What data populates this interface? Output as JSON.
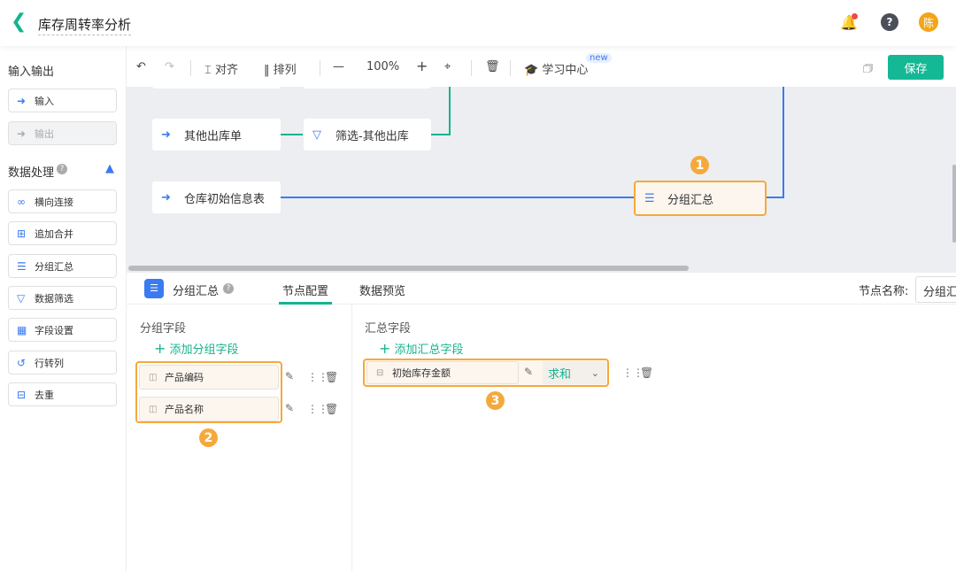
{
  "header": {
    "title": "库存周转率分析",
    "avatar": "陈",
    "help": "?"
  },
  "sidebar": {
    "io_title": "输入输出",
    "io_items": [
      {
        "label": "输入",
        "disabled": false
      },
      {
        "label": "输出",
        "disabled": true
      }
    ],
    "proc_title": "数据处理",
    "proc_items": [
      {
        "label": "横向连接"
      },
      {
        "label": "追加合并"
      },
      {
        "label": "分组汇总"
      },
      {
        "label": "数据筛选"
      },
      {
        "label": "字段设置"
      },
      {
        "label": "行转列"
      },
      {
        "label": "去重"
      }
    ]
  },
  "toolbar": {
    "align": "对齐",
    "arrange": "排列",
    "zoom": "100%",
    "learn": "学习中心",
    "new_badge": "new",
    "save": "保存"
  },
  "canvas": {
    "nodes": [
      {
        "label": "其他出库单"
      },
      {
        "label": "筛选-其他出库"
      },
      {
        "label": "仓库初始信息表"
      },
      {
        "label": "分组汇总"
      }
    ],
    "badge1": "1"
  },
  "panel": {
    "node_title": "分组汇总",
    "tabs": [
      "节点配置",
      "数据预览"
    ],
    "active_tab": "节点配置",
    "node_name_label": "节点名称:",
    "node_name_value": "分组汇总",
    "group_title": "分组字段",
    "add_group": "添加分组字段",
    "group_fields": [
      "产品编码",
      "产品名称"
    ],
    "badge2": "2",
    "sum_title": "汇总字段",
    "add_sum": "添加汇总字段",
    "sum_fields": [
      {
        "name": "初始库存金额",
        "agg": "求和"
      }
    ],
    "badge3": "3"
  },
  "colors": {
    "accent": "#14b894",
    "highlight": "#f5a93c",
    "link_blue": "#3a7bf0"
  }
}
